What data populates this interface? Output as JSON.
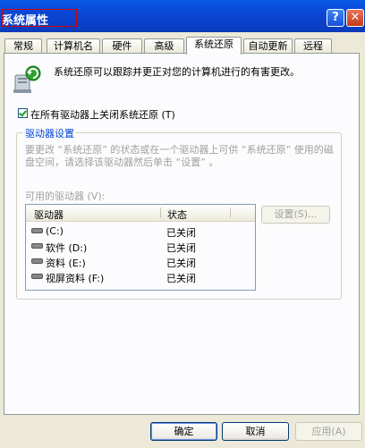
{
  "window": {
    "title": "系统属性",
    "help_glyph": "?",
    "close_glyph": "✕"
  },
  "tabs": [
    {
      "label": "常规"
    },
    {
      "label": "计算机名"
    },
    {
      "label": "硬件"
    },
    {
      "label": "高级"
    },
    {
      "label": "系统还原",
      "active": true
    },
    {
      "label": "自动更新"
    },
    {
      "label": "远程"
    }
  ],
  "intro_text": "系统还原可以跟踪并更正对您的计算机进行的有害更改。",
  "disable_all": {
    "label": "在所有驱动器上关闭系统还原 (T)",
    "checked": true
  },
  "drive_settings": {
    "group_title": "驱动器设置",
    "description": "要更改 “系统还原” 的状态或在一个驱动器上可供 “系统还原” 使用的磁盘空间，请选择该驱动器然后单击 “设置” 。",
    "available_label": "可用的驱动器 (V):",
    "columns": [
      "驱动器",
      "状态"
    ],
    "drives": [
      {
        "name": "(C:)",
        "status": "已关闭"
      },
      {
        "name": "软件 (D:)",
        "status": "已关闭"
      },
      {
        "name": "资料 (E:)",
        "status": "已关闭"
      },
      {
        "name": "视屏资料 (F:)",
        "status": "已关闭"
      }
    ],
    "settings_button": "设置(S)..."
  },
  "buttons": {
    "ok": "确定",
    "cancel": "取消",
    "apply": "应用(A)"
  },
  "colors": {
    "title_bar": "#0a47d4",
    "group_title": "#0046d5",
    "highlight_box": "#d40000"
  }
}
